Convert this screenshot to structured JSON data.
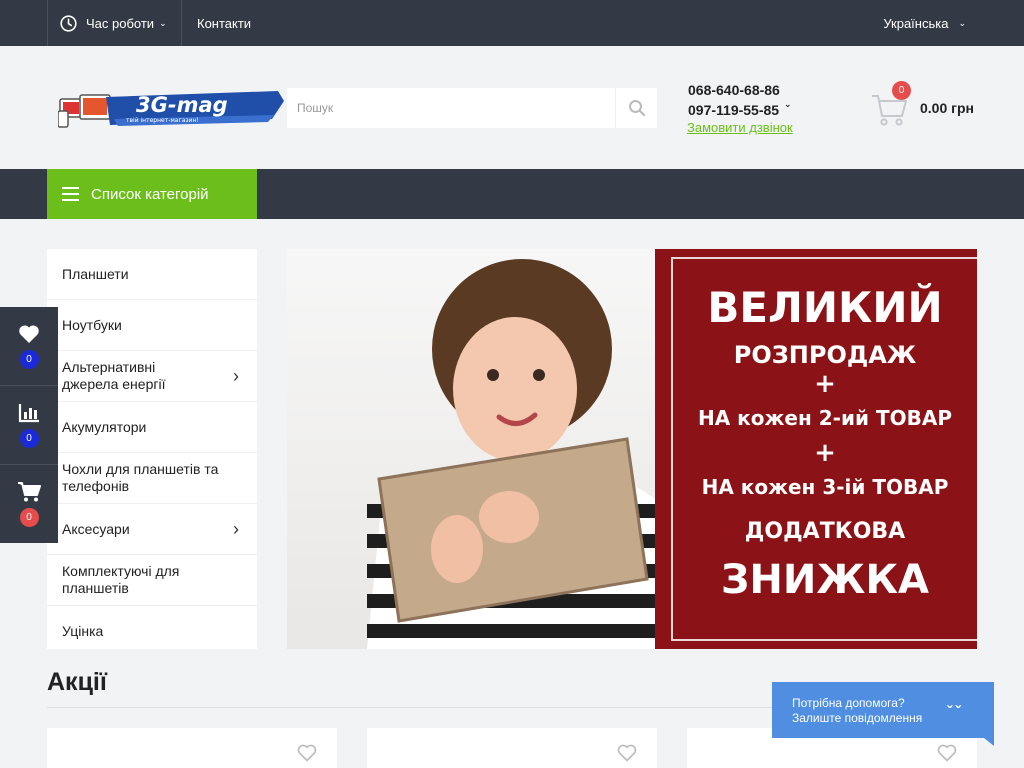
{
  "topbar": {
    "hours_label": "Час роботи",
    "contacts_label": "Контакти",
    "language": "Українська"
  },
  "header": {
    "logo_text": "3G-mag",
    "logo_tagline": "твій інтернет-магазин!",
    "search_placeholder": "Пошук",
    "phone1": "068-640-68-86",
    "phone2": "097-119-55-85",
    "callback_label": "Замовити дзвінок",
    "cart_count": "0",
    "cart_sum": "0.00 грн"
  },
  "nav": {
    "categories_button": "Список категорій"
  },
  "categories": [
    {
      "label": "Планшети",
      "has_sub": false
    },
    {
      "label": "Ноутбуки",
      "has_sub": false
    },
    {
      "label": "Альтернативні джерела енергії",
      "has_sub": true
    },
    {
      "label": "Акумулятори",
      "has_sub": false
    },
    {
      "label": "Чохли для планшетів та телефонів",
      "has_sub": false
    },
    {
      "label": "Аксесуари",
      "has_sub": true
    },
    {
      "label": "Комплектуючі для планшетів",
      "has_sub": false
    },
    {
      "label": "Уцінка",
      "has_sub": false
    }
  ],
  "banner": {
    "lines": [
      "ВЕЛИКИЙ",
      "РОЗПРОДАЖ",
      "+",
      "НА кожен 2-ий ТОВАР",
      "+",
      "НА кожен 3-ій ТОВАР",
      "ДОДАТКОВА",
      "ЗНИЖКА"
    ]
  },
  "floatpanel": {
    "wishlist_count": "0",
    "compare_count": "0",
    "cart_count": "0"
  },
  "promotions": {
    "title": "Акції"
  },
  "help": {
    "line1": "Потрібна допомога?",
    "line2": "Залиште повідомлення"
  },
  "colors": {
    "dark": "#343a45",
    "accent_green": "#6cbf1a",
    "banner_red": "#8b1216",
    "badge_red": "#e74c4c",
    "badge_blue": "#1b2ad8",
    "help_blue": "#4f8ee0"
  }
}
